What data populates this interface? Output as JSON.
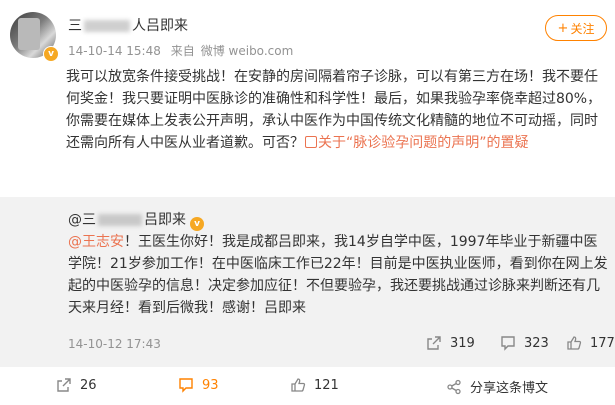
{
  "post": {
    "username_prefix": "三",
    "username_suffix": "人吕即来",
    "timestamp": "14-10-14 15:48",
    "source_prefix": "来自",
    "source": "微博 weibo.com",
    "follow_label": "关注",
    "text_part1": "我可以放宽条件接受挑战！在安静的房间隔着帘子诊脉，可以有第三方在场！我不要任何奖金！我只要证明中医脉诊的准确性和科学性！最后，如果我验孕率侥幸超过80%，你需要在媒体上发表公开声明，承认中医作为中国传统文化精髓的地位不可动摇，同时还需向所有人中医从业者道歉。可否？",
    "link_text": "关于“脉诊验孕问题的声明”的置疑"
  },
  "repost": {
    "username_prefix": "@三",
    "username_suffix": "吕即来",
    "mention": "@王志安",
    "text": "！王医生你好！我是成都吕即来，我14岁自学中医，1997年毕业于新疆中医学院！21岁参加工作！在中医临床工作已22年！目前是中医执业医师，看到你在网上发起的中医验孕的信息！决定参加应征！不但要验孕，我还要挑战通过诊脉来判断还有几天来月经！看到后微我！感谢！吕即来",
    "timestamp": "14-10-12 17:43",
    "reposts": "319",
    "comments": "323",
    "likes": "177"
  },
  "footer": {
    "reposts": "26",
    "comments": "93",
    "likes": "121",
    "share_label": "分享这条博文"
  },
  "colors": {
    "accent": "#ff8200",
    "link": "#eb7350",
    "meta": "#939393",
    "repost_bg": "#f2f2f2"
  }
}
